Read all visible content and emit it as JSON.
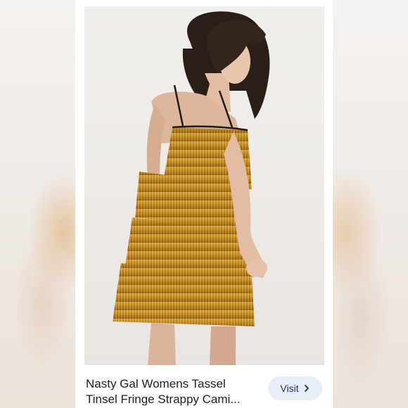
{
  "product": {
    "title_line1": "Nasty Gal Womens Tassel",
    "title_line2": "Tinsel Fringe Strappy Cami...",
    "visit_label": "Visit"
  },
  "icons": {
    "visit_chevron": "chevron-right-icon"
  },
  "colors": {
    "button_bg": "#e8eef9",
    "button_text": "#1b2e57",
    "dress_gold": "#c8911f"
  }
}
